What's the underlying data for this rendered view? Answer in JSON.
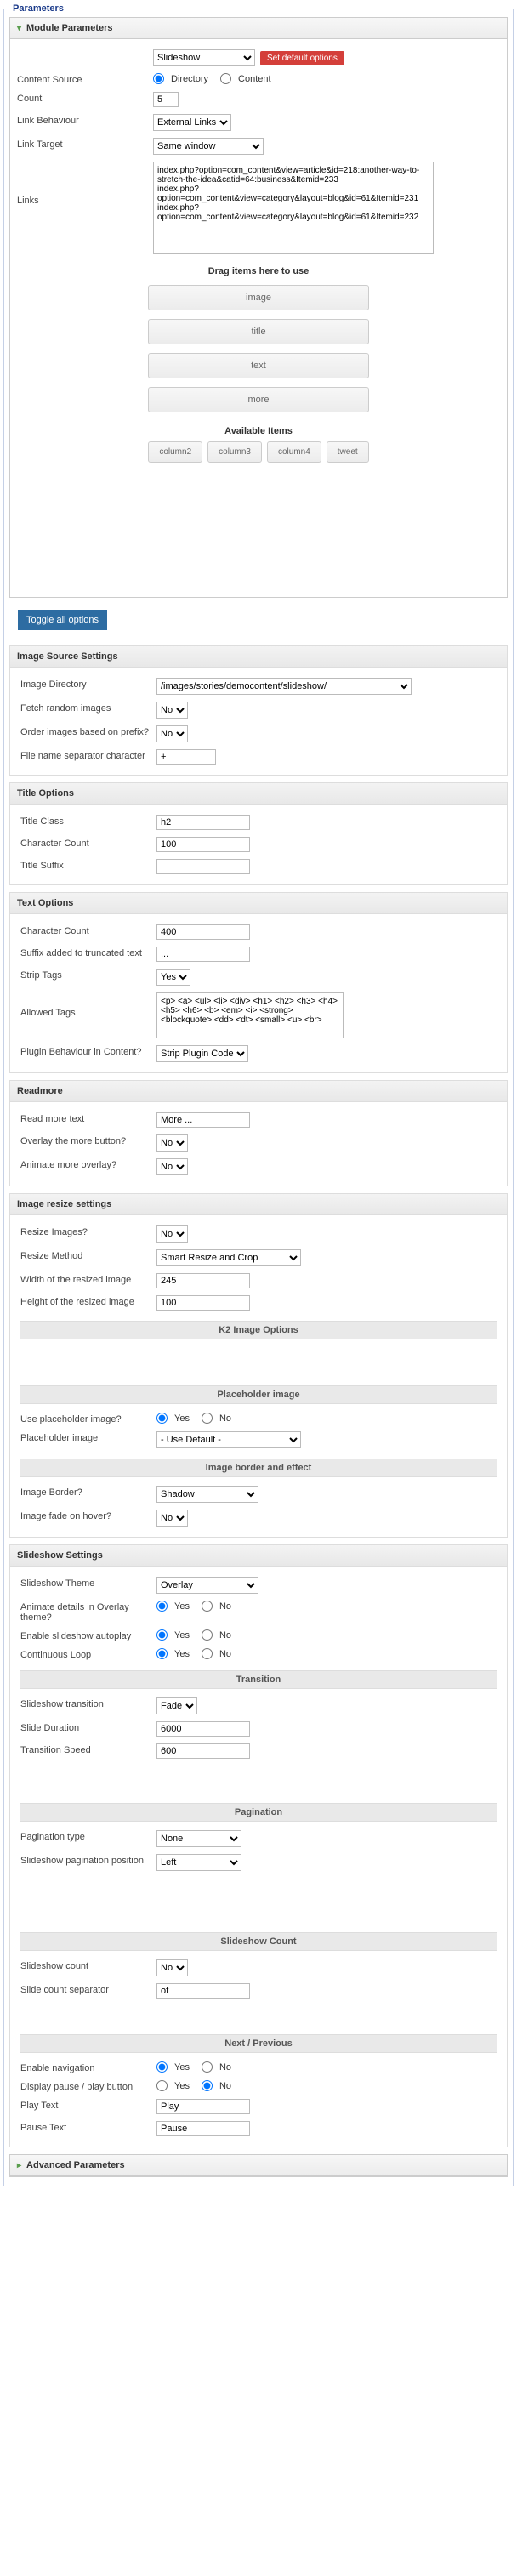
{
  "legend": "Parameters",
  "module_parameters": {
    "title": "Module Parameters",
    "select_opts": [
      "Slideshow"
    ],
    "btn_default": "Set default options",
    "content_source_label": "Content Source",
    "content_source_opts": {
      "directory": "Directory",
      "content": "Content"
    },
    "count_label": "Count",
    "count_value": "5",
    "link_behaviour_label": "Link Behaviour",
    "link_behaviour_opts": [
      "External Links"
    ],
    "link_target_label": "Link Target",
    "link_target_opts": [
      "Same window"
    ],
    "links_label": "Links",
    "links_value": "index.php?option=com_content&view=article&id=218:another-way-to-stretch-the-idea&catid=64:business&Itemid=233\nindex.php?option=com_content&view=category&layout=blog&id=61&Itemid=231\nindex.php?option=com_content&view=category&layout=blog&id=61&Itemid=232",
    "drag_title": "Drag items here to use",
    "slots": [
      "image",
      "title",
      "text",
      "more"
    ],
    "avail_title": "Available Items",
    "avail": [
      "column2",
      "column3",
      "column4",
      "tweet"
    ]
  },
  "toggle_all_btn": "Toggle all options",
  "image_source": {
    "title": "Image Source Settings",
    "image_directory_label": "Image Directory",
    "image_directory_opts": [
      "/images/stories/democontent/slideshow/"
    ],
    "fetch_random_label": "Fetch random images",
    "order_prefix_label": "Order images based on prefix?",
    "filename_sep_label": "File name separator character",
    "filename_sep_value": "+"
  },
  "yesno": {
    "no": "No",
    "yes": "Yes"
  },
  "title_options": {
    "title": "Title Options",
    "class_label": "Title Class",
    "class_value": "h2",
    "char_label": "Character Count",
    "char_value": "100",
    "suffix_label": "Title Suffix",
    "suffix_value": ""
  },
  "text_options": {
    "title": "Text Options",
    "char_label": "Character Count",
    "char_value": "400",
    "suffix_label": "Suffix added to truncated text",
    "suffix_value": "...",
    "strip_label": "Strip Tags",
    "allowed_label": "Allowed Tags",
    "allowed_value": "<p> <a> <ul> <li> <div> <h1> <h2> <h3> <h4> <h5> <h6> <b> <em> <i> <strong> <blockquote> <dd> <dt> <small> <u> <br>",
    "plugin_label": "Plugin Behaviour in Content?",
    "plugin_opts": [
      "Strip Plugin Code"
    ]
  },
  "readmore": {
    "title": "Readmore",
    "text_label": "Read more text",
    "text_value": "More ...",
    "overlay_label": "Overlay the more button?",
    "animate_label": "Animate more overlay?"
  },
  "image_resize": {
    "title": "Image resize settings",
    "resize_label": "Resize Images?",
    "method_label": "Resize Method",
    "method_opts": [
      "Smart Resize and Crop"
    ],
    "width_label": "Width of the resized image",
    "width_value": "245",
    "height_label": "Height of the resized image",
    "height_value": "100",
    "k2_header": "K2 Image Options",
    "ph_header": "Placeholder image",
    "use_ph_label": "Use placeholder image?",
    "ph_img_label": "Placeholder image",
    "ph_img_opts": [
      "- Use Default -"
    ],
    "be_header": "Image border and effect",
    "border_label": "Image Border?",
    "border_opts": [
      "Shadow"
    ],
    "fade_label": "Image fade on hover?"
  },
  "slideshow": {
    "title": "Slideshow Settings",
    "theme_label": "Slideshow Theme",
    "theme_opts": [
      "Overlay"
    ],
    "animate_label": "Animate details in Overlay theme?",
    "autoplay_label": "Enable slideshow autoplay",
    "loop_label": "Continuous Loop",
    "trans_header": "Transition",
    "trans_label": "Slideshow transition",
    "trans_opts": [
      "Fade"
    ],
    "duration_label": "Slide Duration",
    "duration_value": "6000",
    "speed_label": "Transition Speed",
    "speed_value": "600",
    "pag_header": "Pagination",
    "pag_type_label": "Pagination type",
    "pag_type_opts": [
      "None"
    ],
    "pag_pos_label": "Slideshow pagination position",
    "pag_pos_opts": [
      "Left"
    ],
    "count_header": "Slideshow Count",
    "count_label": "Slideshow count",
    "sep_label": "Slide count separator",
    "sep_value": "of",
    "np_header": "Next / Previous",
    "nav_label": "Enable navigation",
    "pp_label": "Display pause / play button",
    "play_label": "Play Text",
    "play_value": "Play",
    "pause_label": "Pause Text",
    "pause_value": "Pause"
  },
  "advanced": {
    "title": "Advanced Parameters"
  }
}
